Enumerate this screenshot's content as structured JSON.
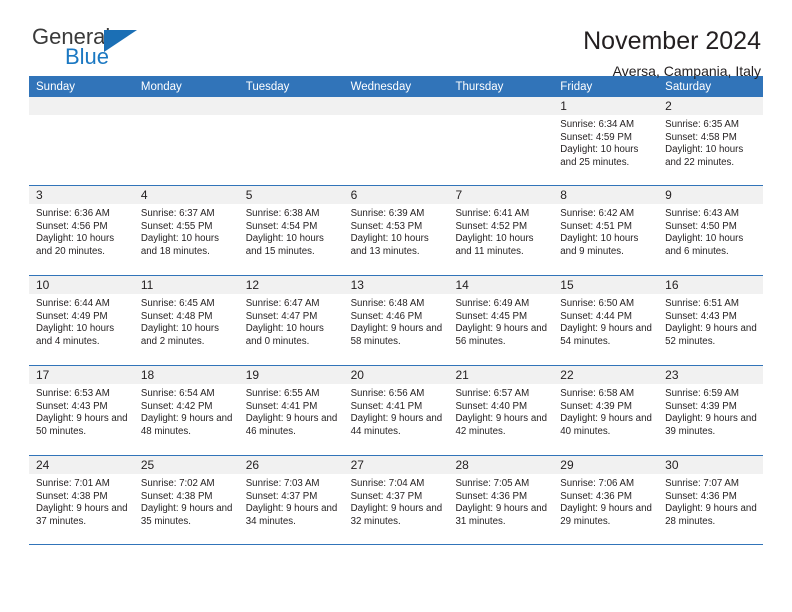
{
  "brand": {
    "name_part1": "General",
    "name_part2": "Blue",
    "accent_color": "#1b78c2"
  },
  "header": {
    "title": "November 2024",
    "subtitle": "Aversa, Campania, Italy"
  },
  "calendar": {
    "header_bg": "#3174b9",
    "weekdays": [
      "Sunday",
      "Monday",
      "Tuesday",
      "Wednesday",
      "Thursday",
      "Friday",
      "Saturday"
    ],
    "weeks": [
      [
        {
          "day": "",
          "empty": true
        },
        {
          "day": "",
          "empty": true
        },
        {
          "day": "",
          "empty": true
        },
        {
          "day": "",
          "empty": true
        },
        {
          "day": "",
          "empty": true
        },
        {
          "day": "1",
          "sunrise": "Sunrise: 6:34 AM",
          "sunset": "Sunset: 4:59 PM",
          "daylight": "Daylight: 10 hours and 25 minutes."
        },
        {
          "day": "2",
          "sunrise": "Sunrise: 6:35 AM",
          "sunset": "Sunset: 4:58 PM",
          "daylight": "Daylight: 10 hours and 22 minutes."
        }
      ],
      [
        {
          "day": "3",
          "sunrise": "Sunrise: 6:36 AM",
          "sunset": "Sunset: 4:56 PM",
          "daylight": "Daylight: 10 hours and 20 minutes."
        },
        {
          "day": "4",
          "sunrise": "Sunrise: 6:37 AM",
          "sunset": "Sunset: 4:55 PM",
          "daylight": "Daylight: 10 hours and 18 minutes."
        },
        {
          "day": "5",
          "sunrise": "Sunrise: 6:38 AM",
          "sunset": "Sunset: 4:54 PM",
          "daylight": "Daylight: 10 hours and 15 minutes."
        },
        {
          "day": "6",
          "sunrise": "Sunrise: 6:39 AM",
          "sunset": "Sunset: 4:53 PM",
          "daylight": "Daylight: 10 hours and 13 minutes."
        },
        {
          "day": "7",
          "sunrise": "Sunrise: 6:41 AM",
          "sunset": "Sunset: 4:52 PM",
          "daylight": "Daylight: 10 hours and 11 minutes."
        },
        {
          "day": "8",
          "sunrise": "Sunrise: 6:42 AM",
          "sunset": "Sunset: 4:51 PM",
          "daylight": "Daylight: 10 hours and 9 minutes."
        },
        {
          "day": "9",
          "sunrise": "Sunrise: 6:43 AM",
          "sunset": "Sunset: 4:50 PM",
          "daylight": "Daylight: 10 hours and 6 minutes."
        }
      ],
      [
        {
          "day": "10",
          "sunrise": "Sunrise: 6:44 AM",
          "sunset": "Sunset: 4:49 PM",
          "daylight": "Daylight: 10 hours and 4 minutes."
        },
        {
          "day": "11",
          "sunrise": "Sunrise: 6:45 AM",
          "sunset": "Sunset: 4:48 PM",
          "daylight": "Daylight: 10 hours and 2 minutes."
        },
        {
          "day": "12",
          "sunrise": "Sunrise: 6:47 AM",
          "sunset": "Sunset: 4:47 PM",
          "daylight": "Daylight: 10 hours and 0 minutes."
        },
        {
          "day": "13",
          "sunrise": "Sunrise: 6:48 AM",
          "sunset": "Sunset: 4:46 PM",
          "daylight": "Daylight: 9 hours and 58 minutes."
        },
        {
          "day": "14",
          "sunrise": "Sunrise: 6:49 AM",
          "sunset": "Sunset: 4:45 PM",
          "daylight": "Daylight: 9 hours and 56 minutes."
        },
        {
          "day": "15",
          "sunrise": "Sunrise: 6:50 AM",
          "sunset": "Sunset: 4:44 PM",
          "daylight": "Daylight: 9 hours and 54 minutes."
        },
        {
          "day": "16",
          "sunrise": "Sunrise: 6:51 AM",
          "sunset": "Sunset: 4:43 PM",
          "daylight": "Daylight: 9 hours and 52 minutes."
        }
      ],
      [
        {
          "day": "17",
          "sunrise": "Sunrise: 6:53 AM",
          "sunset": "Sunset: 4:43 PM",
          "daylight": "Daylight: 9 hours and 50 minutes."
        },
        {
          "day": "18",
          "sunrise": "Sunrise: 6:54 AM",
          "sunset": "Sunset: 4:42 PM",
          "daylight": "Daylight: 9 hours and 48 minutes."
        },
        {
          "day": "19",
          "sunrise": "Sunrise: 6:55 AM",
          "sunset": "Sunset: 4:41 PM",
          "daylight": "Daylight: 9 hours and 46 minutes."
        },
        {
          "day": "20",
          "sunrise": "Sunrise: 6:56 AM",
          "sunset": "Sunset: 4:41 PM",
          "daylight": "Daylight: 9 hours and 44 minutes."
        },
        {
          "day": "21",
          "sunrise": "Sunrise: 6:57 AM",
          "sunset": "Sunset: 4:40 PM",
          "daylight": "Daylight: 9 hours and 42 minutes."
        },
        {
          "day": "22",
          "sunrise": "Sunrise: 6:58 AM",
          "sunset": "Sunset: 4:39 PM",
          "daylight": "Daylight: 9 hours and 40 minutes."
        },
        {
          "day": "23",
          "sunrise": "Sunrise: 6:59 AM",
          "sunset": "Sunset: 4:39 PM",
          "daylight": "Daylight: 9 hours and 39 minutes."
        }
      ],
      [
        {
          "day": "24",
          "sunrise": "Sunrise: 7:01 AM",
          "sunset": "Sunset: 4:38 PM",
          "daylight": "Daylight: 9 hours and 37 minutes."
        },
        {
          "day": "25",
          "sunrise": "Sunrise: 7:02 AM",
          "sunset": "Sunset: 4:38 PM",
          "daylight": "Daylight: 9 hours and 35 minutes."
        },
        {
          "day": "26",
          "sunrise": "Sunrise: 7:03 AM",
          "sunset": "Sunset: 4:37 PM",
          "daylight": "Daylight: 9 hours and 34 minutes."
        },
        {
          "day": "27",
          "sunrise": "Sunrise: 7:04 AM",
          "sunset": "Sunset: 4:37 PM",
          "daylight": "Daylight: 9 hours and 32 minutes."
        },
        {
          "day": "28",
          "sunrise": "Sunrise: 7:05 AM",
          "sunset": "Sunset: 4:36 PM",
          "daylight": "Daylight: 9 hours and 31 minutes."
        },
        {
          "day": "29",
          "sunrise": "Sunrise: 7:06 AM",
          "sunset": "Sunset: 4:36 PM",
          "daylight": "Daylight: 9 hours and 29 minutes."
        },
        {
          "day": "30",
          "sunrise": "Sunrise: 7:07 AM",
          "sunset": "Sunset: 4:36 PM",
          "daylight": "Daylight: 9 hours and 28 minutes."
        }
      ]
    ]
  }
}
